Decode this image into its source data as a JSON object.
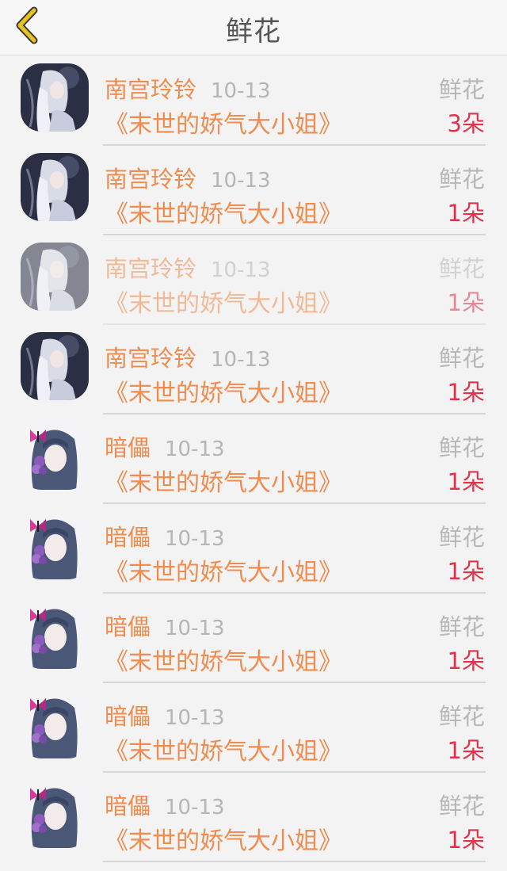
{
  "header": {
    "title": "鲜花",
    "back_icon": "back-chevron-icon",
    "back_icon_color": "#e8c21f"
  },
  "colors": {
    "accent": "#ef8c4f",
    "count": "#e0324b",
    "muted": "#b8b8b8"
  },
  "records": [
    {
      "user": "南宫玲铃",
      "date": "10-13",
      "book": "《末世的娇气大小姐》",
      "gift_type": "鲜花",
      "gift_count": "3朵",
      "avatar": "avatar-white-hair"
    },
    {
      "user": "南宫玲铃",
      "date": "10-13",
      "book": "《末世的娇气大小姐》",
      "gift_type": "鲜花",
      "gift_count": "1朵",
      "avatar": "avatar-white-hair"
    },
    {
      "user": "南宫玲铃",
      "date": "10-13",
      "book": "《末世的娇气大小姐》",
      "gift_type": "鲜花",
      "gift_count": "1朵",
      "avatar": "avatar-white-hair"
    },
    {
      "user": "南宫玲铃",
      "date": "10-13",
      "book": "《末世的娇气大小姐》",
      "gift_type": "鲜花",
      "gift_count": "1朵",
      "avatar": "avatar-white-hair"
    },
    {
      "user": "暗儡",
      "date": "10-13",
      "book": "《末世的娇气大小姐》",
      "gift_type": "鲜花",
      "gift_count": "1朵",
      "avatar": "avatar-butterfly-girl"
    },
    {
      "user": "暗儡",
      "date": "10-13",
      "book": "《末世的娇气大小姐》",
      "gift_type": "鲜花",
      "gift_count": "1朵",
      "avatar": "avatar-butterfly-girl"
    },
    {
      "user": "暗儡",
      "date": "10-13",
      "book": "《末世的娇气大小姐》",
      "gift_type": "鲜花",
      "gift_count": "1朵",
      "avatar": "avatar-butterfly-girl"
    },
    {
      "user": "暗儡",
      "date": "10-13",
      "book": "《末世的娇气大小姐》",
      "gift_type": "鲜花",
      "gift_count": "1朵",
      "avatar": "avatar-butterfly-girl"
    },
    {
      "user": "暗儡",
      "date": "10-13",
      "book": "《末世的娇气大小姐》",
      "gift_type": "鲜花",
      "gift_count": "1朵",
      "avatar": "avatar-butterfly-girl"
    }
  ]
}
